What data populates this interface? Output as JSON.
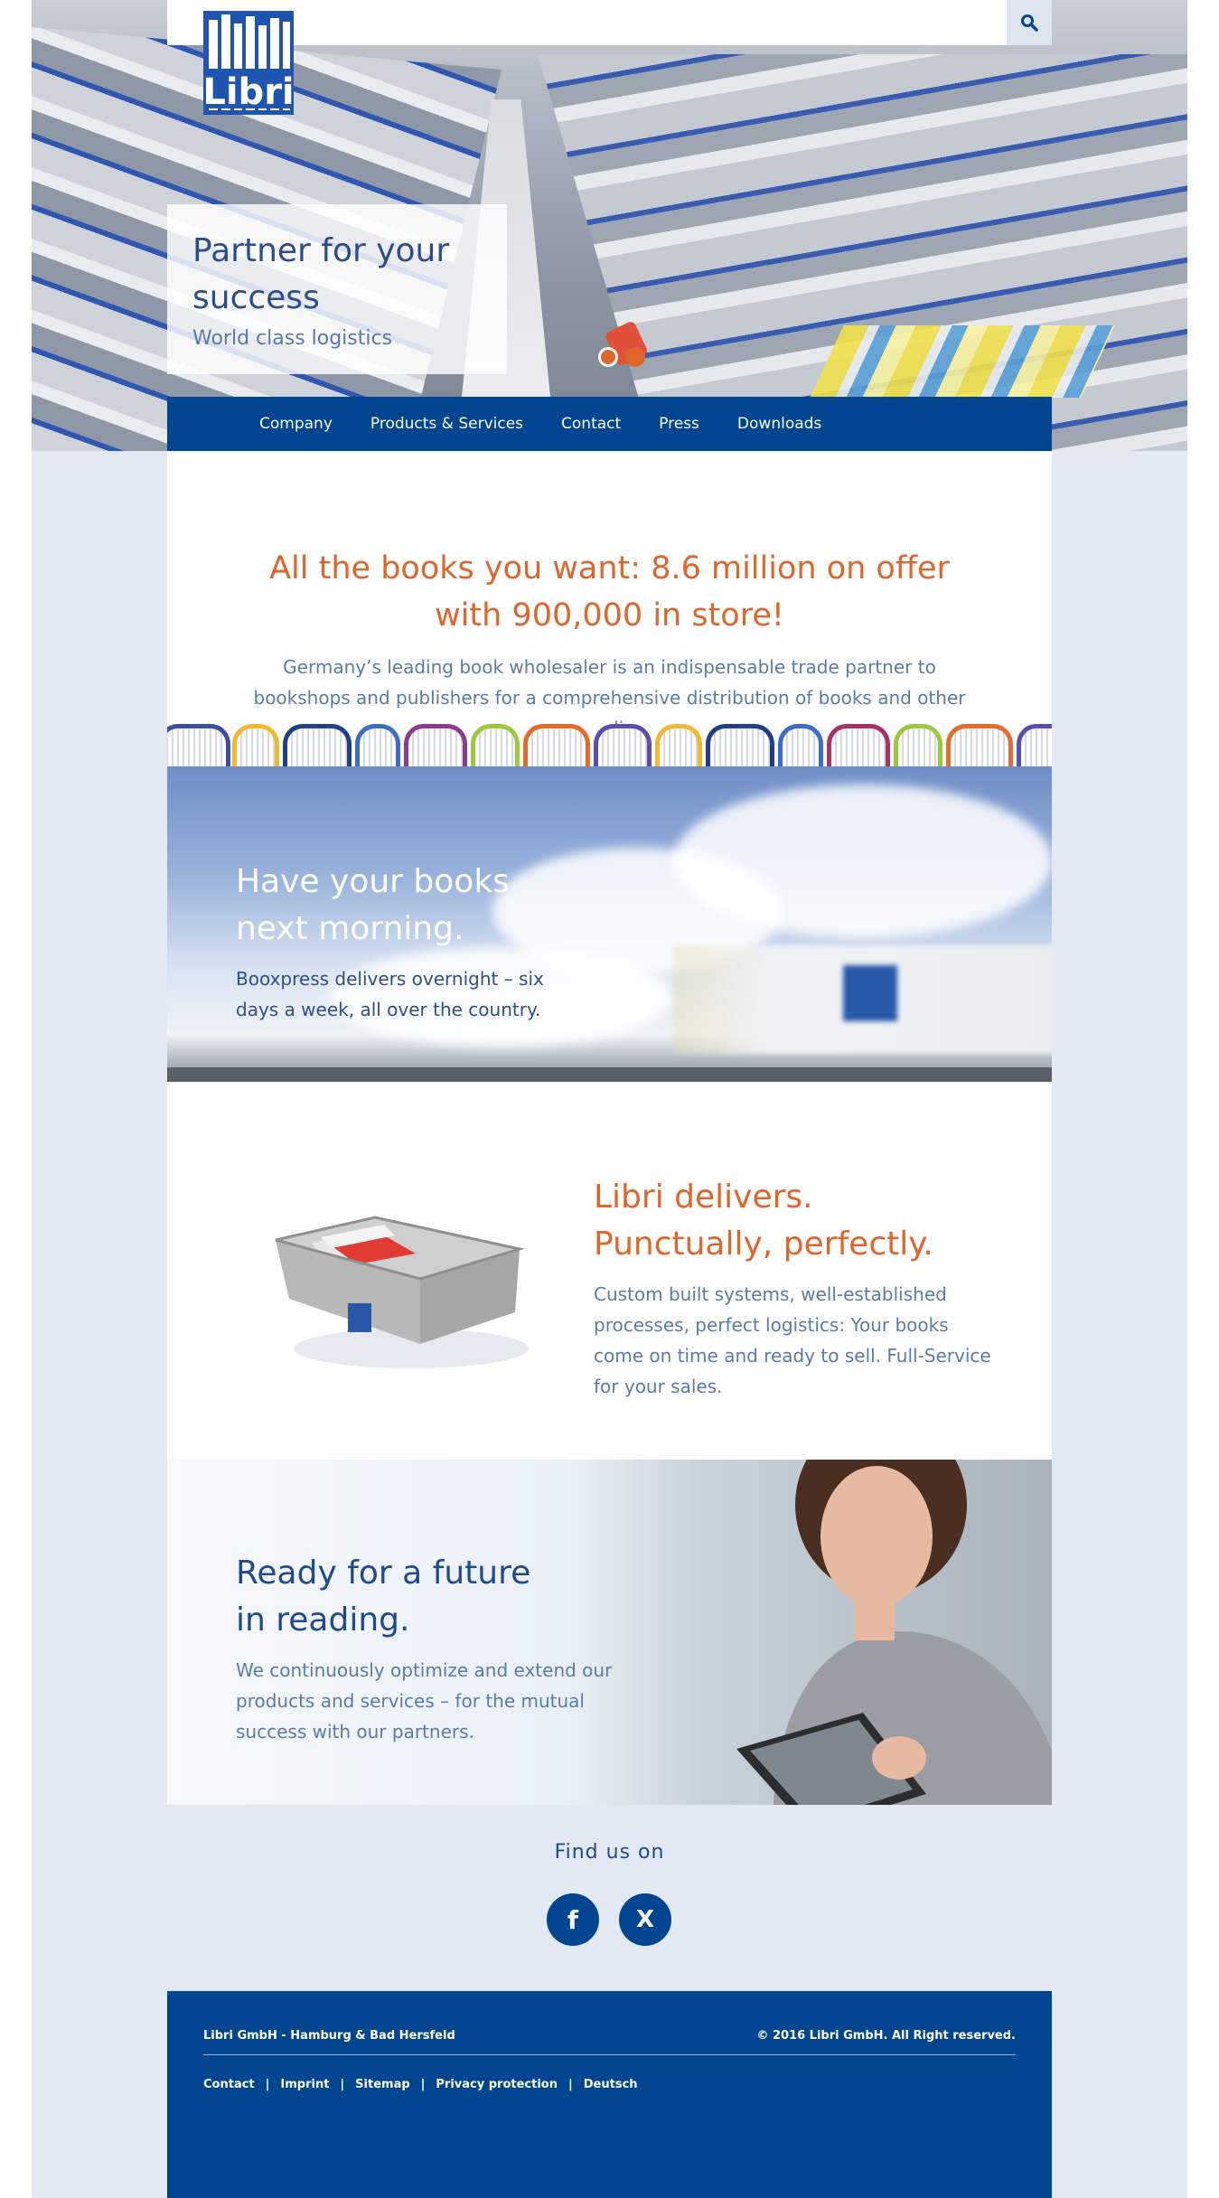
{
  "brand": {
    "logo_text": "Libri",
    "accent": "#e0652a",
    "navy": "#004590"
  },
  "hero": {
    "title": "Partner for your success",
    "subtitle": "World class logistics",
    "search_icon": "search-icon"
  },
  "nav": {
    "items": [
      "Company",
      "Products & Services",
      "Contact",
      "Press",
      "Downloads"
    ]
  },
  "intro": {
    "title": "All the books you want: 8.6 million on offer with 900,000 in store!",
    "text": "Germany’s leading book wholesaler is an indispensable trade partner to bookshops and publishers for a comprehensive distribution of books and other media."
  },
  "truck": {
    "title": "Have your books next morning.",
    "text": "Booxpress delivers overnight – six days a week, all over the country."
  },
  "delivery": {
    "title_line1": "Libri delivers.",
    "title_line2": "Punctually, perfectly.",
    "text": "Custom built systems, well-established processes, perfect logistics: Your books come on time and ready to sell. Full-Service for your sales."
  },
  "future": {
    "title": "Ready for a future in reading.",
    "text": "We continuously optimize and extend our products and services – for the mutual success with our partners."
  },
  "social": {
    "heading": "Find us on",
    "facebook_glyph": "f",
    "xing_glyph": "X"
  },
  "footer": {
    "company": "Libri GmbH - Hamburg & Bad Hersfeld",
    "copyright": "© 2016 Libri GmbH. All Right reserved.",
    "links": [
      "Contact",
      "Imprint",
      "Sitemap",
      "Privacy protection",
      "Deutsch"
    ],
    "separator": "|"
  }
}
